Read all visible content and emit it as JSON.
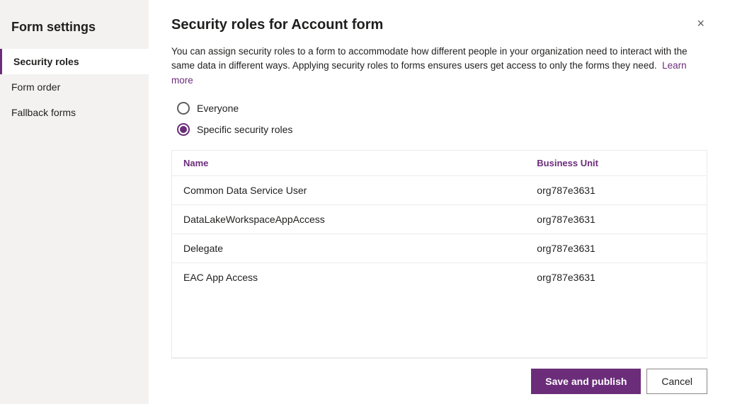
{
  "sidebar": {
    "title": "Form settings",
    "items": [
      {
        "id": "security-roles",
        "label": "Security roles",
        "active": true
      },
      {
        "id": "form-order",
        "label": "Form order",
        "active": false
      },
      {
        "id": "fallback-forms",
        "label": "Fallback forms",
        "active": false
      }
    ]
  },
  "dialog": {
    "title": "Security roles for Account form",
    "close_icon": "×",
    "description_1": "You can assign security roles to a form to accommodate how different people in your organization need to interact with the same data in different ways. Applying security roles to forms ensures users get access to only the forms they need.",
    "learn_more_label": "Learn more",
    "learn_more_href": "#",
    "radio_options": [
      {
        "id": "everyone",
        "label": "Everyone",
        "checked": false
      },
      {
        "id": "specific",
        "label": "Specific security roles",
        "checked": true
      }
    ],
    "table": {
      "columns": [
        {
          "id": "name",
          "label": "Name"
        },
        {
          "id": "business_unit",
          "label": "Business Unit"
        }
      ],
      "rows": [
        {
          "name": "Common Data Service User",
          "business_unit": "org787e3631"
        },
        {
          "name": "DataLakeWorkspaceAppAccess",
          "business_unit": "org787e3631"
        },
        {
          "name": "Delegate",
          "business_unit": "org787e3631"
        },
        {
          "name": "EAC App Access",
          "business_unit": "org787e3631"
        }
      ]
    }
  },
  "footer": {
    "save_label": "Save and publish",
    "cancel_label": "Cancel"
  }
}
